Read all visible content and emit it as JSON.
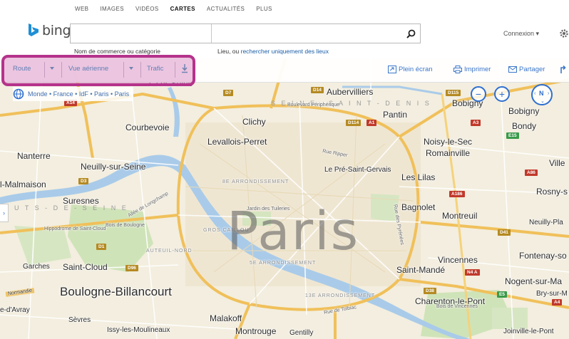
{
  "header": {
    "nav": [
      "WEB",
      "IMAGES",
      "VIDÉOS",
      "CARTES",
      "ACTUALITÉS",
      "PLUS"
    ],
    "active_nav": "CARTES",
    "logo_text": "bing",
    "business_placeholder": "",
    "place_placeholder": "",
    "hint_business": "Nom de commerce ou catégorie",
    "hint_place_prefix": "Lieu, ou ",
    "hint_place_link": "rechercher uniquement des lieux",
    "signin_label": "Connexion ▾"
  },
  "toolbar": {
    "road_label": "Route",
    "aerial_label": "Vue aérienne",
    "traffic_label": "Trafic",
    "fullscreen_label": "Plein écran",
    "print_label": "Imprimer",
    "share_label": "Partager"
  },
  "breadcrumb": "Monde • France • IdF • Paris • Paris",
  "map": {
    "city_label": "Paris",
    "compass_label": "N",
    "zoom_in": "+",
    "zoom_out": "−",
    "labels": {
      "aubervilliers": "Aubervilliers",
      "bobigny1": "Bobigny",
      "bobigny2": "Bobigny",
      "bondy": "Bondy",
      "pantin": "Pantin",
      "noisy": "Noisy-le-Sec",
      "romainville": "Romainville",
      "lilas": "Les Lilas",
      "pre": "Le Pré-Saint-Gervais",
      "bagnolet": "Bagnolet",
      "montreuil": "Montreuil",
      "rosny": "Rosny-s",
      "neuilly_pl": "Neuilly-Pla",
      "fontenay": "Fontenay-so",
      "vincennes": "Vincennes",
      "saint_mande": "Saint-Mandé",
      "nogent": "Nogent-sur-Ma",
      "bry": "Bry-sur-M",
      "charenton": "Charenton-le-Pont",
      "joinville": "Joinville-le-Pont",
      "ville": "Ville",
      "clichy": "Clichy",
      "levallois": "Levallois-Perret",
      "courbevoie": "Courbevoie",
      "nanterre": "Nanterre",
      "neuilly": "Neuilly-sur-Seine",
      "malmaison": "l-Malmaison",
      "suresnes": "Suresnes",
      "saint_cloud": "Saint-Cloud",
      "garches": "Garches",
      "boulogne": "Boulogne-Billancourt",
      "sevres": "Sèvres",
      "issy": "Issy-les-Moulineaux",
      "malakoff": "Malakoff",
      "montrouge": "Montrouge",
      "gentilly": "Gentilly",
      "ville_avray": "e-d'Avray",
      "sur_seine": "s-sur-Seine",
      "normandie": "Normandie",
      "arr8": "8e Arrondissement",
      "arr5": "5e Arrondissement",
      "arr13": "13e Arrondissement",
      "gros_caillou": "Gros Caillou",
      "auteuil": "Auteuil-Nord",
      "seine_st_denis": "S E I N E - S A I N T - D E N I S",
      "hauts_de_seine": "A U T S - D E - S E I N E",
      "bois_boulogne": "Bois de Boulogne",
      "bois_vincennes": "Bois de Vincennes",
      "hippodrome": "Hippodrome de Saint-Cloud",
      "allee": "Allée de Longchamp",
      "bd_peripherique": "Boulevard Périphérique",
      "rue_tolbiac": "Rue de Tolbiac",
      "rue_ripper": "Rue Ripper",
      "jardin": "Jardin des Tuileries",
      "rue_pyrenees": "Rue des Pyrénées"
    },
    "shields": {
      "d14": "D14",
      "d115": "D115",
      "a1": "A1",
      "a3": "A3",
      "e15": "E15",
      "a86": "A86",
      "d7": "D7",
      "a14": "A14",
      "d3": "D3",
      "n4a": "N4 A",
      "d41": "D41",
      "e5": "E5",
      "a4": "A4",
      "d1": "D1",
      "d96": "D96",
      "d38": "D38",
      "d114": "D114",
      "a186": "A186"
    }
  }
}
